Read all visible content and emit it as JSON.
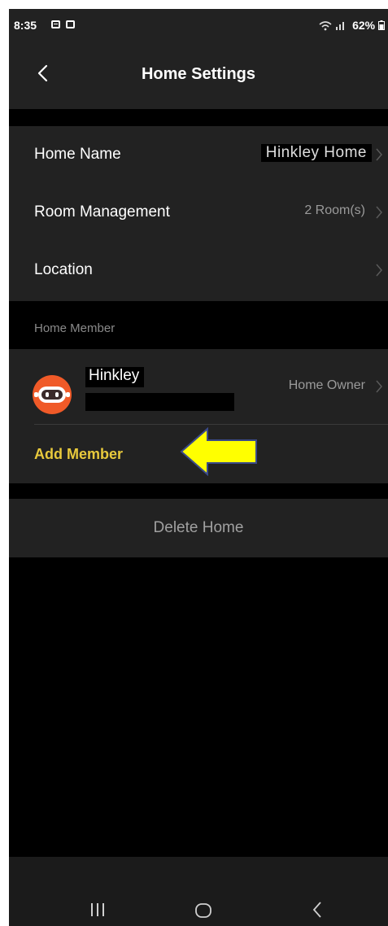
{
  "status_bar": {
    "time": "8:35",
    "battery": "62%",
    "signal_icons": "wifi-signal-icon"
  },
  "header": {
    "title": "Home Settings",
    "back_icon": "back-arrow-icon"
  },
  "home": {
    "name_label": "Home Name",
    "name_value": "Hinkley Home",
    "rooms_label": "Room Management",
    "rooms_value": "2 Room(s)",
    "location_label": "Location"
  },
  "members": {
    "section_title": "Home Member",
    "items": [
      {
        "name": "Hinkley",
        "role": "Home Owner",
        "avatar": "robot-avatar-icon"
      }
    ],
    "add_label": "Add Member"
  },
  "actions": {
    "delete_label": "Delete Home"
  },
  "annotation": {
    "arrow_color": "#ffff00",
    "arrow_icon": "left-arrow-annotation-icon"
  },
  "colors": {
    "background": "#000000",
    "surface": "#222222",
    "accent": "#e8c93c",
    "secondary_text": "#9a9a9a"
  }
}
